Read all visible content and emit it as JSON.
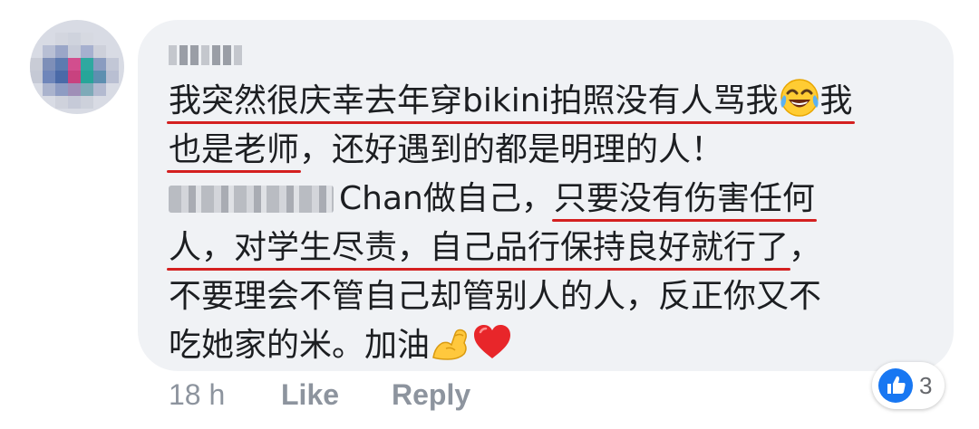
{
  "comment": {
    "author_name": "",
    "lines": {
      "l1_text": "我突然很庆幸去年穿bikini拍照没有人骂我",
      "l1_tail": "我",
      "l2_underlined": "也是老师",
      "l2_rest": "，还好遇到的都是明理的人！",
      "l3_chan": "Chan做自己，",
      "l3_underlined": "只要没有伤害任何",
      "l4_underlined": "人，对学生尽责，自己品行保持良好就行了",
      "l4_rest": "，",
      "l5": "不要理会不管自己却管别人的人，反正你又不",
      "l6": "吃她家的米。加油"
    },
    "emojis": [
      "tears-of-joy-icon",
      "flexed-biceps-icon",
      "red-heart-icon"
    ]
  },
  "footer": {
    "time": "18 h",
    "like_label": "Like",
    "reply_label": "Reply"
  },
  "reactions": {
    "icon": "thumbs-up-icon",
    "count": "3"
  },
  "colors": {
    "bubble": "#f0f2f5",
    "text": "#1c1e21",
    "meta": "#8d949e",
    "underline": "#d42020",
    "like_blue": "#1877f2"
  }
}
